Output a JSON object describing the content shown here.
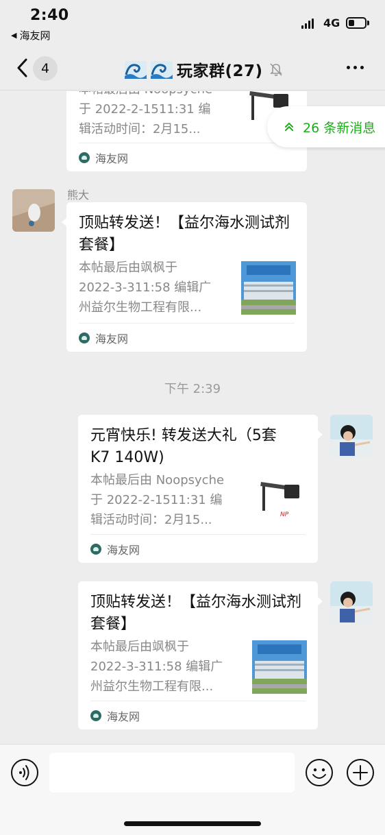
{
  "status_bar": {
    "time": "2:40",
    "back_app": "海友网",
    "network": "4G"
  },
  "nav": {
    "unread_count": "4",
    "title": "玩家群(27)"
  },
  "new_messages": {
    "label": "26 条新消息"
  },
  "messages": [
    {
      "side": "left",
      "sender": "",
      "title": "",
      "desc_lines": [
        "本帖最后由 Noopsyche",
        "于 2022-2-1511:31 编",
        "辑活动时间：2月15..."
      ],
      "source": "海友网",
      "thumb": "light-fixture"
    },
    {
      "side": "left",
      "sender": "熊大",
      "title": "顶贴转发送！【益尔海水测试剂套餐】",
      "desc_lines": [
        "本帖最后由飒枫于",
        "2022-3-311:58 编辑广",
        "州益尔生物工程有限..."
      ],
      "source": "海友网",
      "thumb": "building"
    },
    {
      "side": "right",
      "sender": "",
      "title": "元宵快乐! 转发送大礼（5套K7 140W)",
      "desc_lines": [
        "本帖最后由 Noopsyche",
        "于 2022-2-1511:31 编",
        "辑活动时间：2月15..."
      ],
      "source": "海友网",
      "thumb": "light-fixture"
    },
    {
      "side": "right",
      "sender": "",
      "title": "顶贴转发送！【益尔海水测试剂套餐】",
      "desc_lines": [
        "本帖最后由飒枫于",
        "2022-3-311:58 编辑广",
        "州益尔生物工程有限..."
      ],
      "source": "海友网",
      "thumb": "building"
    }
  ],
  "timestamp": "下午 2:39",
  "icons": {
    "back": "chevron-left-icon",
    "mute": "bell-slash-icon",
    "more": "more-dots-icon",
    "voice": "voice-icon",
    "emoji": "emoji-icon",
    "plus": "plus-icon",
    "new_messages": "double-chevron-up-icon"
  },
  "colors": {
    "accent": "#1aad19",
    "background": "#ededed",
    "bubble": "#ffffff"
  }
}
